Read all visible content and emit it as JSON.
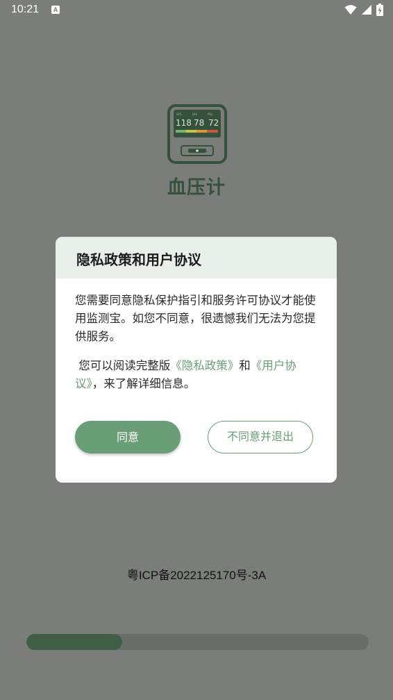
{
  "status_bar": {
    "time": "10:21",
    "notification_icon": "a-icon",
    "icons": [
      "wifi-icon",
      "signal-icon",
      "battery-charging-icon"
    ]
  },
  "app": {
    "name": "血压计",
    "logo_icon": "blood-pressure-monitor-icon",
    "logo_readings": [
      "118",
      "78",
      "72"
    ],
    "logo_labels": [
      "SYS",
      "DIA",
      "PUL"
    ]
  },
  "dialog": {
    "title": "隐私政策和用户协议",
    "para1": "您需要同意隐私保护指引和服务许可协议才能使用监测宝。如您不同意，很遗憾我们无法为您提供服务。",
    "para2_prefix": "您可以阅读完整版",
    "privacy_link": "《隐私政策》",
    "para2_and": "和",
    "agreement_link": "《用户协议》",
    "para2_suffix": "，来了解详细信息。",
    "agree_label": "同意",
    "disagree_label": "不同意并退出"
  },
  "footer": {
    "icp": "粤ICP备2022125170号-3A"
  },
  "progress": {
    "value": 0.28
  },
  "colors": {
    "accent": "#6a9e77",
    "dark_green": "#35513b",
    "overlay": "#7b7d7b"
  }
}
